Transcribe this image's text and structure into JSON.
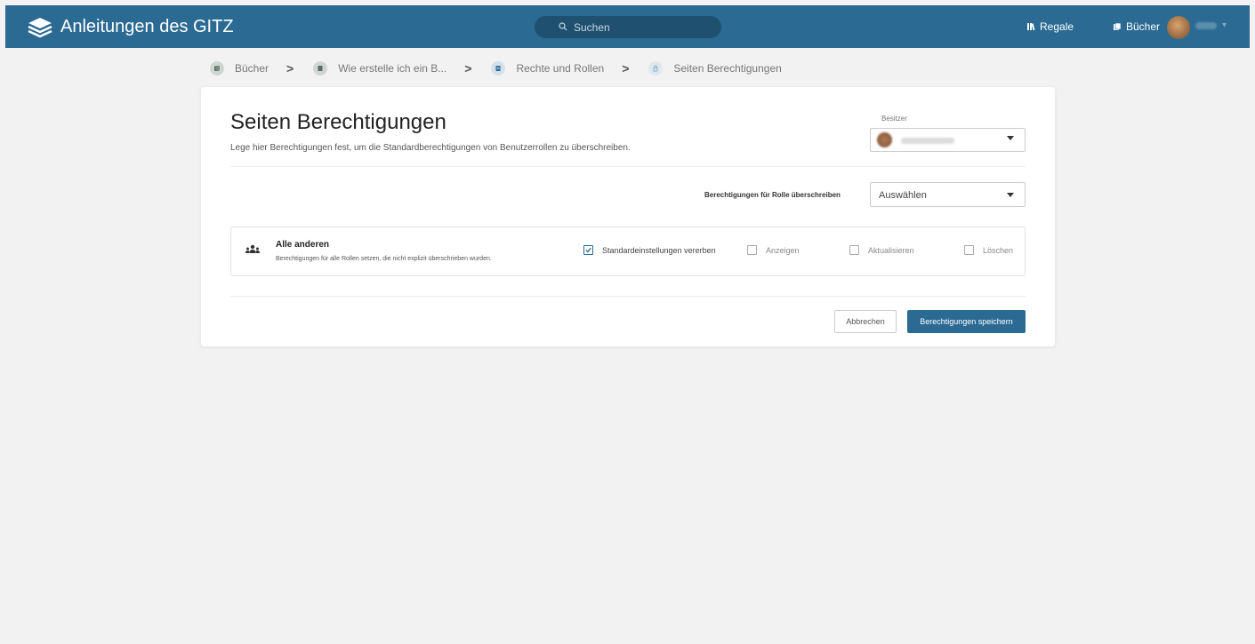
{
  "colors": {
    "header_bg": "#2b6a92",
    "accent": "#2b6a92",
    "book_icon_bg": "#cfd6d2",
    "chapter_icon_bg": "#d5e1ea",
    "page_icon_bg": "#dfe7ee"
  },
  "header": {
    "logo_icon": "stacked-books-icon",
    "title": "Anleitungen des GITZ",
    "search": {
      "placeholder": "Suchen",
      "icon": "search-icon"
    },
    "nav": [
      {
        "label": "Regale",
        "icon": "shelves-icon"
      },
      {
        "label": "Bücher",
        "icon": "books-icon"
      }
    ],
    "user_caret": "▾"
  },
  "breadcrumb": {
    "separator": ">",
    "items": [
      {
        "label": "Bücher",
        "icon": "books-icon"
      },
      {
        "label": "Wie erstelle ich ein B...",
        "icon": "book-icon"
      },
      {
        "label": "Rechte und Rollen",
        "icon": "chapter-icon"
      },
      {
        "label": "Seiten Berechtigungen",
        "icon": "lock-icon"
      }
    ]
  },
  "main": {
    "title": "Seiten Berechtigungen",
    "description": "Lege hier Berechtigungen fest, um die Standardberechtigungen von Benutzerrollen zu überschreiben.",
    "owner_label": "Besitzer",
    "role_override_label": "Berechtigungen für Rolle überschreiben",
    "role_select_value": "Auswählen",
    "permission_row": {
      "title": "Alle anderen",
      "description": "Berechtigungen für alle Rollen setzen, die nicht explizit überschrieben wurden.",
      "options": [
        {
          "label": "Standardeinstellungen vererben",
          "checked": true
        },
        {
          "label": "Anzeigen",
          "checked": false
        },
        {
          "label": "Aktualisieren",
          "checked": false
        },
        {
          "label": "Löschen",
          "checked": false
        }
      ]
    },
    "cancel_label": "Abbrechen",
    "save_label": "Berechtigungen speichern"
  }
}
